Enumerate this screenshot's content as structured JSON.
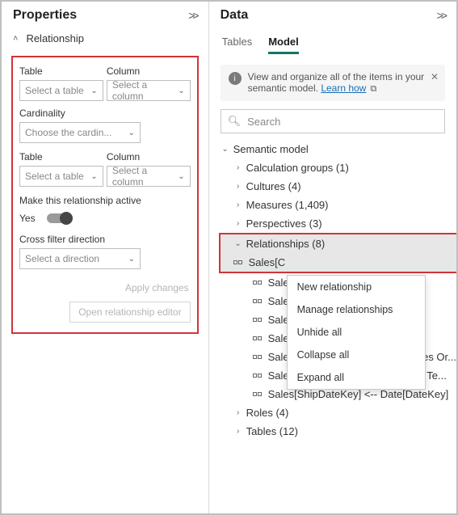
{
  "properties": {
    "title": "Properties",
    "section": "Relationship",
    "table_label": "Table",
    "column_label": "Column",
    "select_table_ph": "Select a table",
    "select_column_ph": "Select a column",
    "cardinality_label": "Cardinality",
    "cardinality_ph": "Choose the cardin...",
    "active_label": "Make this relationship active",
    "active_value": "Yes",
    "cross_filter_label": "Cross filter direction",
    "cross_filter_ph": "Select a direction",
    "apply_btn": "Apply changes",
    "editor_btn": "Open relationship editor"
  },
  "data": {
    "title": "Data",
    "tabs": {
      "tables": "Tables",
      "model": "Model"
    },
    "info_text": "View and organize all of the items in your semantic model. ",
    "info_link": "Learn how",
    "search_ph": "Search",
    "tree": {
      "root": "Semantic model",
      "calc_groups": "Calculation groups (1)",
      "cultures": "Cultures (4)",
      "measures": "Measures (1,409)",
      "perspectives": "Perspectives (3)",
      "relationships": "Relationships (8)",
      "rel_items": [
        "Sales[C",
        "Sales[D",
        "Sales[C",
        "Sales[P",
        "Sales[S",
        "Sales[SalesOrderLineKey] — Sales Or...",
        "Sales[SalesTerritoryKey] <- Sales Te...",
        "Sales[ShipDateKey] <-- Date[DateKey]"
      ],
      "roles": "Roles (4)",
      "tables_node": "Tables (12)"
    },
    "context_menu": [
      "New relationship",
      "Manage relationships",
      "Unhide all",
      "Collapse all",
      "Expand all"
    ]
  }
}
